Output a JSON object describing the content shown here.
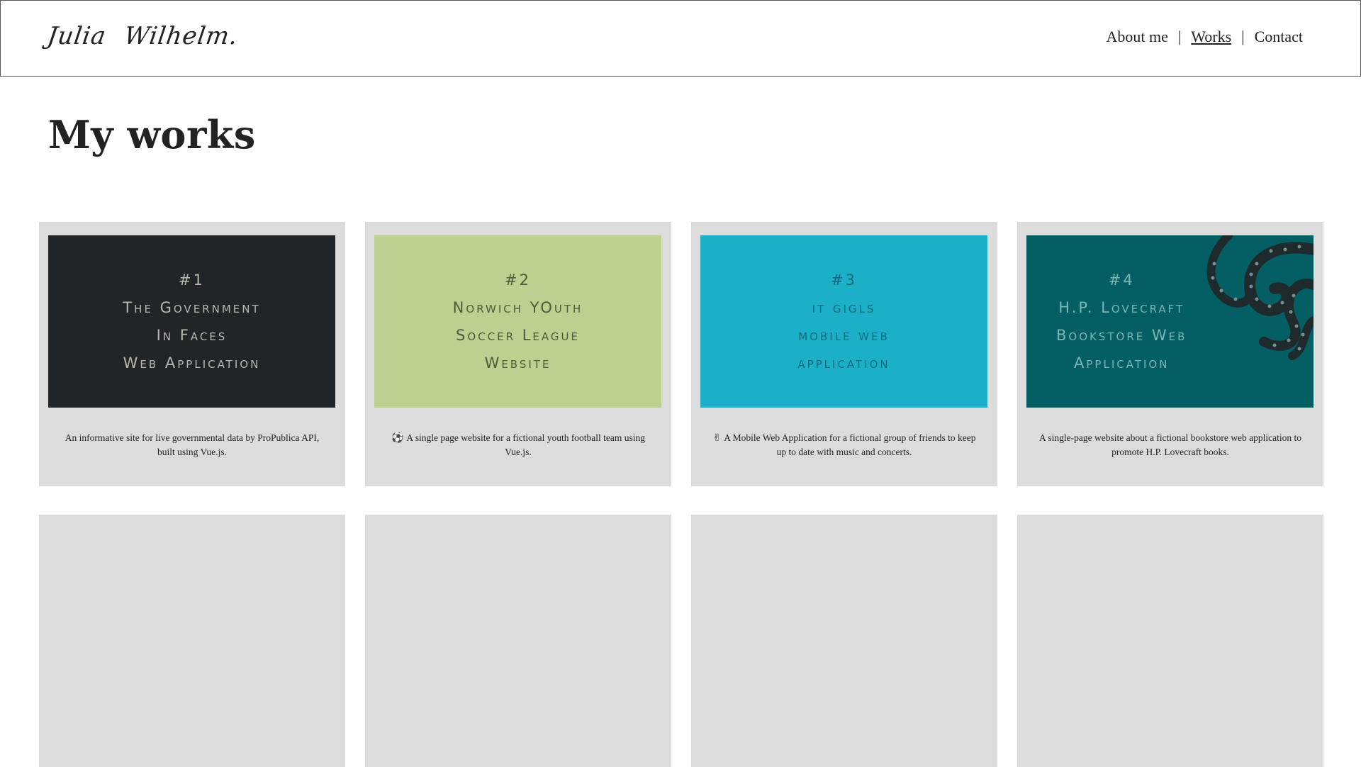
{
  "header": {
    "logo": {
      "first": "Julia",
      "last": "Wilhelm."
    },
    "nav": [
      {
        "label": "About me",
        "active": false
      },
      {
        "label": "Works",
        "active": true
      },
      {
        "label": "Contact",
        "active": false
      }
    ],
    "separator": "|"
  },
  "page": {
    "title": "My works"
  },
  "works": [
    {
      "lines": [
        "#1",
        "The Government",
        "In Faces",
        "Web Application"
      ],
      "description": "An informative site for live governmental data by ProPublica API, built using Vue.js.",
      "icon": "",
      "thumb_color": "#222528"
    },
    {
      "lines": [
        "#2",
        "Norwich YOuth",
        "Soccer League",
        "Website"
      ],
      "description": "A single page website for a fictional youth football team using Vue.js.",
      "icon": "⚽",
      "icon_name": "soccer-ball-icon",
      "thumb_color": "#bdd08f"
    },
    {
      "lines": [
        "#3",
        "it gigls",
        "mobile web",
        "application"
      ],
      "description": "A Mobile Web Application for a fictional group of friends to keep up to date with music and concerts.",
      "icon": "✌",
      "icon_name": "rock-hand-icon",
      "thumb_color": "#1bb0c8"
    },
    {
      "lines": [
        "#4",
        "H.P. Lovecraft",
        "Bookstore Web",
        "Application"
      ],
      "description": "A single-page website about a fictional bookstore web application to promote H.P. Lovecraft books.",
      "icon": "",
      "icon_name": "octopus-tentacles-image",
      "thumb_color": "#035f63"
    }
  ]
}
